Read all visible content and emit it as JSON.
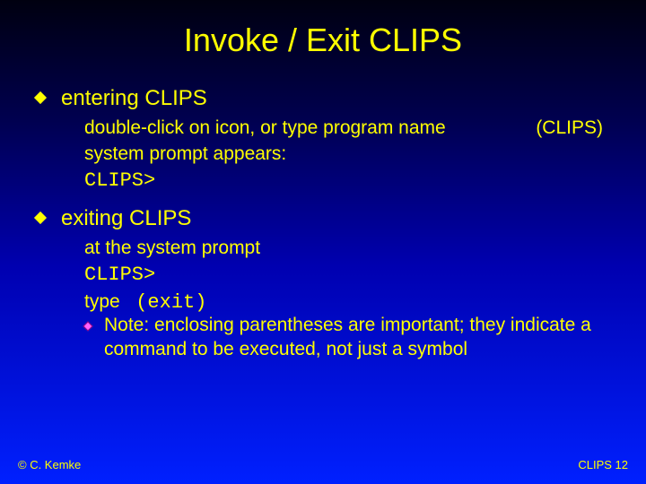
{
  "title": "Invoke / Exit CLIPS",
  "sections": {
    "entering": {
      "heading": "entering CLIPS",
      "line1": "double-click on icon, or type program name",
      "line1_paren": "(CLIPS)",
      "line2": "system prompt appears:",
      "prompt": "CLIPS>"
    },
    "exiting": {
      "heading": "exiting CLIPS",
      "line1": "at the system prompt",
      "prompt": "CLIPS>",
      "type_label": "type",
      "type_cmd": "(exit)",
      "note": "Note: enclosing parentheses are important; they indicate a command to be executed, not just a symbol"
    }
  },
  "footer": {
    "left": "© C. Kemke",
    "right": "CLIPS  12"
  }
}
